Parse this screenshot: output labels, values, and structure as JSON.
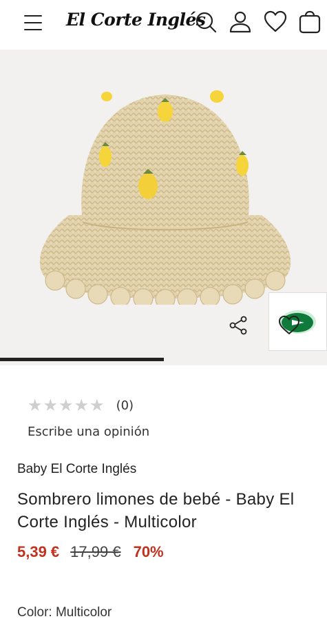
{
  "header": {
    "logo_text": "El Corte Inglés",
    "icons": [
      "menu-icon",
      "search-icon",
      "user-icon",
      "heart-icon",
      "bag-icon"
    ]
  },
  "gallery": {
    "image_subject": "straw bucket hat with lemons",
    "progress": 0.5,
    "icons": [
      "share-icon",
      "wishlist-heart-icon",
      "promo-play-icon"
    ],
    "accent_color": "#0f7a3a"
  },
  "product": {
    "rating_stars": "★★★★★",
    "rating_value": 0,
    "rating_count": "(0)",
    "review_link": "Escribe una opinión",
    "brand": "Baby El Corte Inglés",
    "title": "Sombrero limones de bebé - Baby El Corte Inglés - Multicolor",
    "price_now": "5,39 €",
    "price_old": "17,99 €",
    "discount": "70%",
    "color_label": "Color: Multicolor"
  },
  "colors": {
    "price": "#c0321e",
    "stars_empty": "#cfcfcf"
  }
}
